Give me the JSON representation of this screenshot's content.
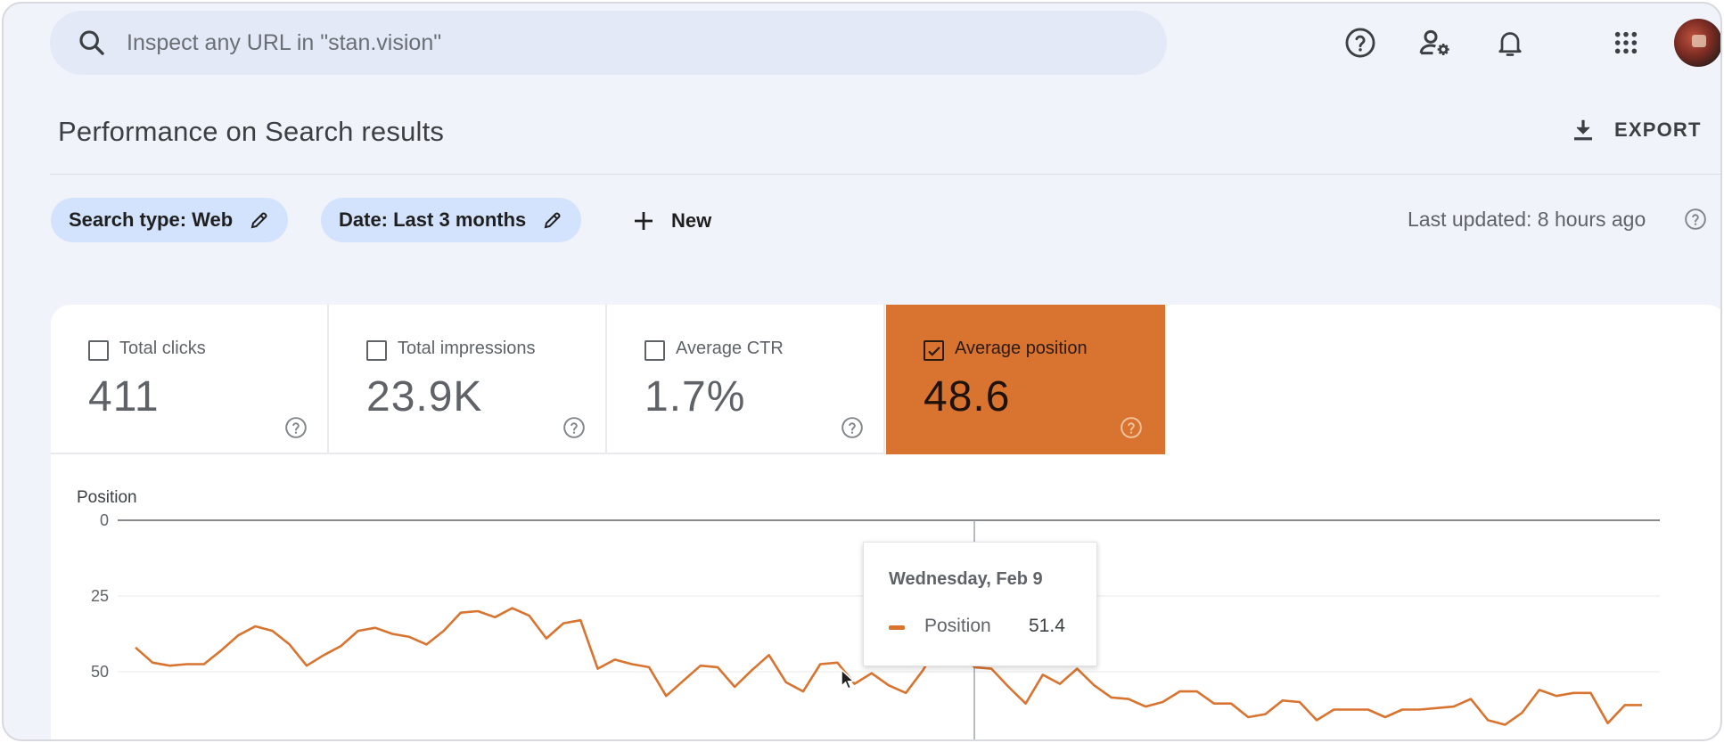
{
  "search": {
    "placeholder": "Inspect any URL in \"stan.vision\"",
    "icon": "search-icon"
  },
  "header_icons": [
    "help-icon",
    "manage-users-icon",
    "notifications-icon",
    "apps-grid-icon",
    "avatar"
  ],
  "page": {
    "title": "Performance on Search results",
    "export_label": "EXPORT"
  },
  "filters": {
    "chips": [
      {
        "label": "Search type: Web"
      },
      {
        "label": "Date: Last 3 months"
      }
    ],
    "new_label": "New",
    "last_updated": "Last updated: 8 hours ago"
  },
  "metrics": [
    {
      "label": "Total clicks",
      "value": "411",
      "checked": false
    },
    {
      "label": "Total impressions",
      "value": "23.9K",
      "checked": false
    },
    {
      "label": "Average CTR",
      "value": "1.7%",
      "checked": false
    },
    {
      "label": "Average position",
      "value": "48.6",
      "checked": true,
      "color": "#d97430"
    }
  ],
  "tooltip": {
    "date": "Wednesday, Feb 9",
    "series": "Position",
    "value": "51.4"
  },
  "colors": {
    "accent": "#d97430",
    "chip_bg": "#d3e3fd",
    "search_bg": "#e3e9f7"
  },
  "chart_data": {
    "type": "line",
    "ylabel": "Position",
    "y_reversed": true,
    "ylim": [
      0,
      75
    ],
    "yticks": [
      "0",
      "25",
      "50"
    ],
    "grid": true,
    "series": [
      {
        "name": "Position",
        "color": "#d97430",
        "values": [
          42,
          47,
          48,
          47.5,
          47.5,
          43,
          38,
          35,
          36.5,
          41,
          48,
          44.5,
          41.5,
          36.5,
          35.5,
          37.5,
          38.5,
          41,
          36.5,
          30.5,
          30,
          32,
          29,
          31.5,
          39,
          34,
          33,
          49,
          46,
          47.5,
          48.5,
          58,
          53,
          48,
          48.5,
          55,
          49.5,
          44.5,
          53.5,
          56.5,
          47.5,
          47,
          54,
          50.5,
          54.5,
          57,
          49.5,
          40,
          42.5,
          48.5,
          49,
          55,
          60.5,
          51,
          54,
          49,
          54.5,
          58.5,
          59,
          61.5,
          60,
          56.5,
          56.5,
          60.5,
          60.5,
          65,
          64,
          59.5,
          60,
          66,
          62.5,
          62.5,
          62.5,
          65,
          62.5,
          62.5,
          62,
          61.5,
          59,
          66,
          67.5,
          63.5,
          56,
          58,
          57,
          57,
          67,
          61,
          61
        ]
      }
    ],
    "highlight": {
      "x_label": "Wednesday, Feb 9",
      "value": 51.4
    }
  }
}
